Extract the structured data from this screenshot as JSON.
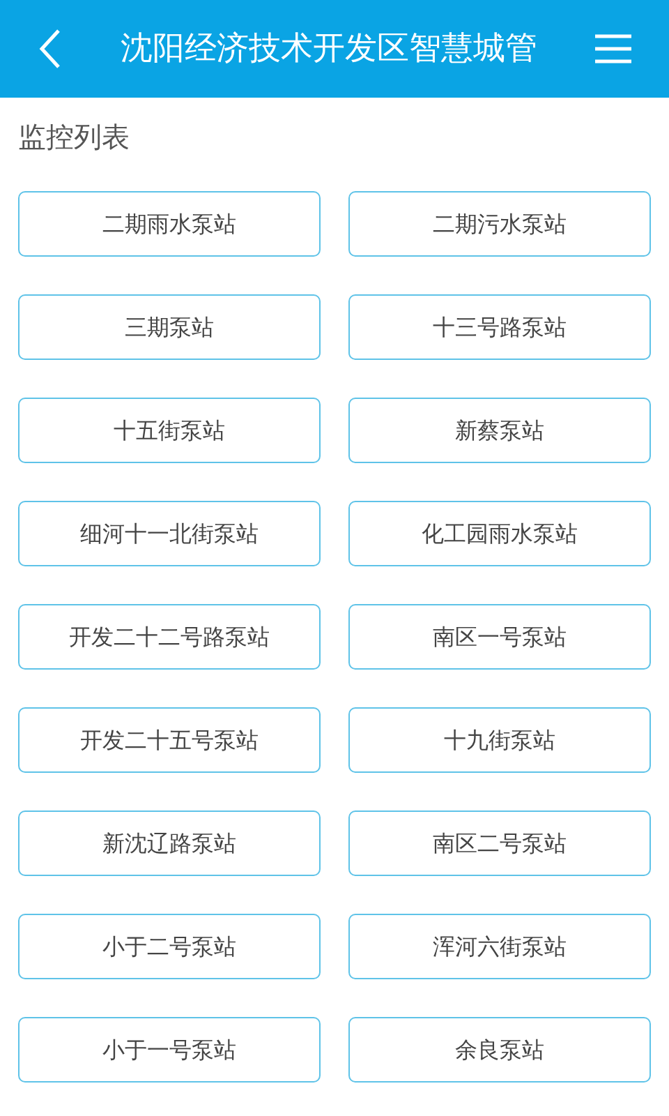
{
  "header": {
    "title": "沈阳经济技术开发区智慧城管"
  },
  "section": {
    "title": "监控列表"
  },
  "stations": [
    {
      "name": "二期雨水泵站"
    },
    {
      "name": "二期污水泵站"
    },
    {
      "name": "三期泵站"
    },
    {
      "name": "十三号路泵站"
    },
    {
      "name": "十五街泵站"
    },
    {
      "name": "新蔡泵站"
    },
    {
      "name": "细河十一北街泵站"
    },
    {
      "name": "化工园雨水泵站"
    },
    {
      "name": "开发二十二号路泵站"
    },
    {
      "name": "南区一号泵站"
    },
    {
      "name": "开发二十五号泵站"
    },
    {
      "name": "十九街泵站"
    },
    {
      "name": "新沈辽路泵站"
    },
    {
      "name": "南区二号泵站"
    },
    {
      "name": "小于二号泵站"
    },
    {
      "name": "浑河六街泵站"
    },
    {
      "name": "小于一号泵站"
    },
    {
      "name": "余良泵站"
    }
  ]
}
